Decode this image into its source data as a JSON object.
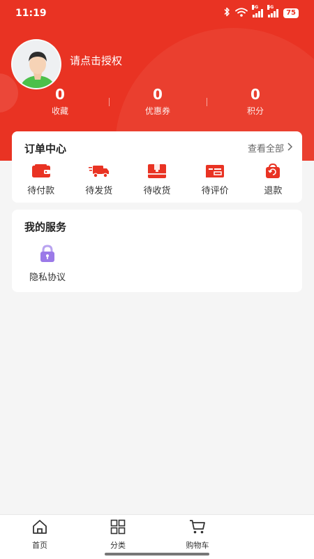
{
  "status_bar": {
    "time": "11:19",
    "battery": "75",
    "network1": "5G",
    "network2": "5G"
  },
  "profile": {
    "auth_text": "请点击授权"
  },
  "stats": [
    {
      "value": "0",
      "label": "收藏"
    },
    {
      "value": "0",
      "label": "优惠券"
    },
    {
      "value": "0",
      "label": "积分"
    }
  ],
  "orders": {
    "title": "订单中心",
    "view_all": "查看全部",
    "items": [
      {
        "label": "待付款",
        "icon": "wallet-icon"
      },
      {
        "label": "待发货",
        "icon": "truck-icon"
      },
      {
        "label": "待收货",
        "icon": "package-icon"
      },
      {
        "label": "待评价",
        "icon": "review-icon"
      },
      {
        "label": "退款",
        "icon": "refund-bag-icon"
      }
    ]
  },
  "services": {
    "title": "我的服务",
    "items": [
      {
        "label": "隐私协议",
        "icon": "lock-icon"
      }
    ]
  },
  "tabbar": {
    "items": [
      {
        "label": "首页",
        "icon": "home-icon"
      },
      {
        "label": "分类",
        "icon": "grid-icon"
      },
      {
        "label": "购物车",
        "icon": "cart-icon"
      }
    ]
  },
  "colors": {
    "brand": "#e93323",
    "icon_purple": "#9b7ae8",
    "background": "#f5f5f5"
  }
}
